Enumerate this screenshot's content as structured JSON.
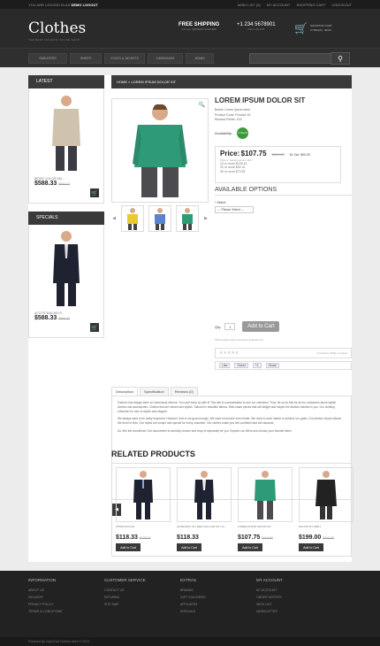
{
  "topbar": {
    "welcome": "YOU ARE LOGGED IN AS",
    "user": "DEMO",
    "logout": "LOGOUT",
    "links": [
      "WISH LIST (0)",
      "MY ACCOUNT",
      "SHOPPING CART",
      "CHECKOUT"
    ]
  },
  "header": {
    "logo": "Clothes",
    "tagline": "THE BEST FASHION ONLINE SHOP",
    "shipping_title": "FREE SHIPPING",
    "shipping_sub": "ON ALL ORDERS OVER $99",
    "phone": "+1 234 5678901",
    "phone_sub": "CALL US 24/7",
    "cart_title": "SHOPPING CART",
    "cart_sub": "0 ITEM(S) - $0.00"
  },
  "menu": {
    "items": [
      "SWEATERS",
      "SHIRTS",
      "COATS & JACKETS",
      "CARDIGANS",
      "JEANS"
    ],
    "search_placeholder": ""
  },
  "sidebar": {
    "latest_title": "LATEST",
    "latest_name": "BEIGE COLOR DEL...",
    "latest_price": "$588.33",
    "latest_old": "$693.33",
    "specials_title": "SPECIALS",
    "special_name": "ACCITE MACNIN P...",
    "special_price": "$588.33",
    "special_old": "$693.33"
  },
  "breadcrumb": "HOME » LOREM IPSUM DOLOR SIT",
  "product": {
    "title": "LOREM IPSUM DOLOR SIT",
    "brand": "Brand: Lorem ipsum dolor",
    "code": "Product Code: Product 15",
    "reward": "Reward Points: 100",
    "availability_label": "Availability:",
    "stock": "In Stock",
    "price_label": "Price:",
    "price": "$107.75",
    "price_old": "$119.50",
    "ex_tax": "Ex Tax: $90.00",
    "points": "Price in reward points: 400",
    "discounts": [
      "10 or more $105.41",
      "20 or more $92.41",
      "30 or more $73.51"
    ],
    "options_title": "AVAILABLE OPTIONS",
    "select_label": "* Select:",
    "select_value": "--- Please Select ---",
    "qty_label": "Qty:",
    "qty": "1",
    "add_to_cart": "Add to Cart",
    "min_note": "This product has a minimum quantity of 2",
    "reviews": "0 reviews",
    "write_review": "Write a review",
    "share": [
      "Like",
      "Tweet",
      "+1",
      "Share"
    ]
  },
  "tabs": [
    "Description",
    "Specification",
    "Reviews (0)"
  ],
  "description": [
    "Fashion has always been so immensely diverse. You can't keep up with it! This site is a presentation to see our collection. Thus, let us do this for all our customers about stylish clothes and accessories. Clothes that are vibrant and stylish. Tailored in beautiful fabrics. Well-made pieces that will delight and inspire the fashion-minded in you. Our clothing collection for men is stylish and elegant.",
    "We always want to be really important. However, that is not good enough. We want to become even better. We need to work harder to achieve our goals. Our fashion house follows the trend of time. Our styles are unique and special for every customer. Our clothes make you feel confident and self-assured.",
    "So, feel the excellence! Our assortment is carefully chosen and shop is especially for you. Explore our offers and choose your favorite items."
  ],
  "related": {
    "title": "RELATED PRODUCTS",
    "items": [
      {
        "name": "IPSUM DOLOR",
        "price": "$118.33",
        "old": "$138.33",
        "btn": "Add to Cart"
      },
      {
        "name": "QUAEUEST SIT EMAI NULLAM SIT LIA",
        "price": "$118.33",
        "old": "",
        "btn": "Add to Cart"
      },
      {
        "name": "LOREM IPSUM DOLOR SIT",
        "price": "$107.75",
        "old": "$119.50",
        "btn": "Add to Cart"
      },
      {
        "name": "DOLOR SIT AMET",
        "price": "$199.00",
        "old": "$240.00",
        "btn": "Add to Cart"
      }
    ]
  },
  "footer": {
    "columns": [
      {
        "title": "INFORMATION",
        "links": [
          "ABOUT US",
          "DELIVERY",
          "PRIVACY POLICY",
          "TERMS & CONDITIONS"
        ]
      },
      {
        "title": "CUSTOMER SERVICE",
        "links": [
          "CONTACT US",
          "RETURNS",
          "SITE MAP"
        ]
      },
      {
        "title": "EXTRAS",
        "links": [
          "BRANDS",
          "GIFT VOUCHERS",
          "AFFILIATES",
          "SPECIALS"
        ]
      },
      {
        "title": "MY ACCOUNT",
        "links": [
          "MY ACCOUNT",
          "ORDER HISTORY",
          "WISH LIST",
          "NEWSLETTER"
        ]
      }
    ],
    "copyright": "Powered By OpenCart Clothes store © 2013"
  }
}
